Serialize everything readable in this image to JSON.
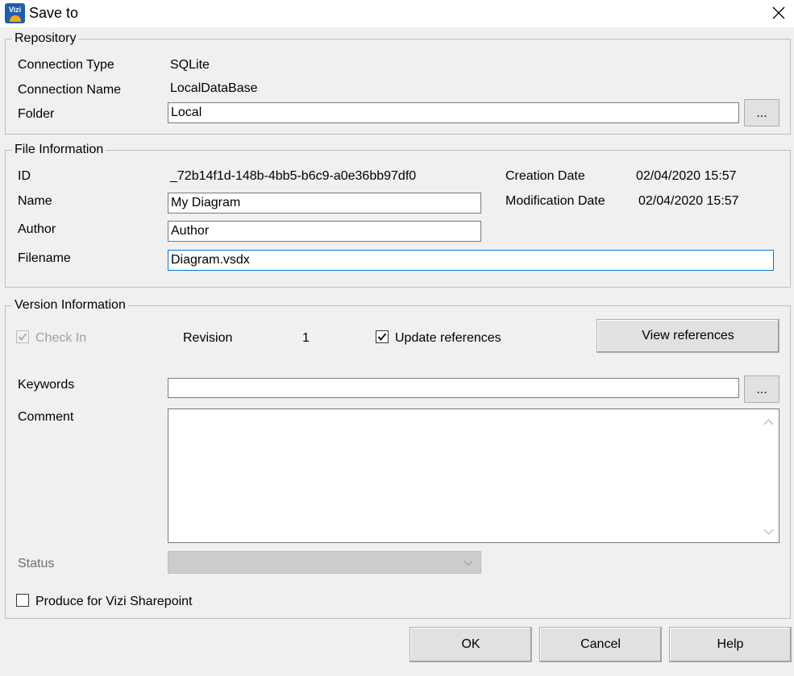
{
  "window": {
    "title": "Save to",
    "app_icon_text": "Vizi"
  },
  "repository": {
    "legend": "Repository",
    "connection_type_label": "Connection Type",
    "connection_type_value": "SQLite",
    "connection_name_label": "Connection Name",
    "connection_name_value": "LocalDataBase",
    "folder_label": "Folder",
    "folder_value": "Local",
    "browse_label": "..."
  },
  "file_information": {
    "legend": "File Information",
    "id_label": "ID",
    "id_value": "_72b14f1d-148b-4bb5-b6c9-a0e36bb97df0",
    "creation_date_label": "Creation Date",
    "creation_date_value": "02/04/2020 15:57",
    "modification_date_label": "Modification Date",
    "modification_date_value": "02/04/2020 15:57",
    "name_label": "Name",
    "name_value": "My Diagram",
    "author_label": "Author",
    "author_value": "Author",
    "filename_label": "Filename",
    "filename_value": "Diagram.vsdx"
  },
  "version_information": {
    "legend": "Version Information",
    "check_in_label": "Check In",
    "check_in_checked": true,
    "check_in_enabled": false,
    "revision_label": "Revision",
    "revision_value": "1",
    "update_references_label": "Update references",
    "update_references_checked": true,
    "view_references_label": "View references",
    "keywords_label": "Keywords",
    "keywords_value": "",
    "keywords_browse_label": "...",
    "comment_label": "Comment",
    "comment_value": "",
    "status_label": "Status",
    "status_value": "",
    "produce_sharepoint_label": "Produce for Vizi Sharepoint",
    "produce_sharepoint_checked": false
  },
  "footer": {
    "ok_label": "OK",
    "cancel_label": "Cancel",
    "help_label": "Help"
  }
}
